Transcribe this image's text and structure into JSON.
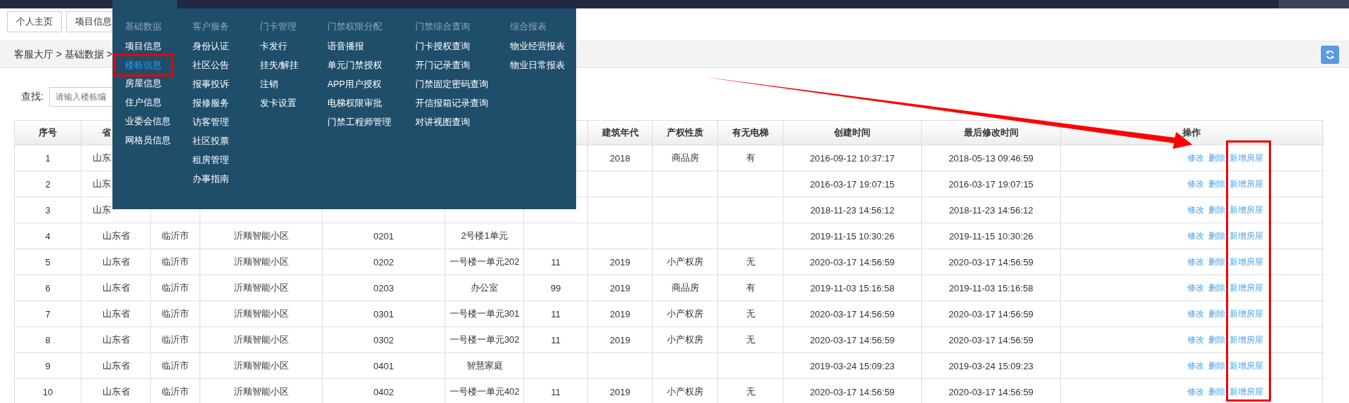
{
  "tabs": [
    {
      "label": "个人主页",
      "selected": false
    },
    {
      "label": "项目信息",
      "selected": false
    }
  ],
  "breadcrumb": "客服大厅 > 基础数据 >",
  "search": {
    "label": "查找:",
    "placeholder": "请输入楼栋编"
  },
  "menu": {
    "columns": [
      {
        "heading": "基础数据",
        "items": [
          {
            "label": "项目信息",
            "selected": false
          },
          {
            "label": "楼栋信息",
            "selected": true
          },
          {
            "label": "房屋信息",
            "selected": false
          },
          {
            "label": "住户信息",
            "selected": false
          },
          {
            "label": "业委会信息",
            "selected": false
          },
          {
            "label": "网格员信息",
            "selected": false
          }
        ]
      },
      {
        "heading": "客户服务",
        "items": [
          {
            "label": "身份认证",
            "selected": false
          },
          {
            "label": "社区公告",
            "selected": false
          },
          {
            "label": "报事投诉",
            "selected": false
          },
          {
            "label": "报修服务",
            "selected": false
          },
          {
            "label": "访客管理",
            "selected": false
          },
          {
            "label": "社区投票",
            "selected": false
          },
          {
            "label": "租房管理",
            "selected": false
          },
          {
            "label": "办事指南",
            "selected": false
          }
        ]
      },
      {
        "heading": "门卡管理",
        "items": [
          {
            "label": "卡发行",
            "selected": false
          },
          {
            "label": "挂失/解挂",
            "selected": false
          },
          {
            "label": "注销",
            "selected": false
          },
          {
            "label": "发卡设置",
            "selected": false
          }
        ]
      },
      {
        "heading": "门禁权限分配",
        "items": [
          {
            "label": "语音播报",
            "selected": false
          },
          {
            "label": "单元门禁授权",
            "selected": false
          },
          {
            "label": "APP用户授权",
            "selected": false
          },
          {
            "label": "电梯权限审批",
            "selected": false
          },
          {
            "label": "门禁工程师管理",
            "selected": false
          }
        ]
      },
      {
        "heading": "门禁综合查询",
        "items": [
          {
            "label": "门卡授权查询",
            "selected": false
          },
          {
            "label": "开门记录查询",
            "selected": false
          },
          {
            "label": "门禁固定密码查询",
            "selected": false
          },
          {
            "label": "开信报箱记录查询",
            "selected": false
          },
          {
            "label": "对讲视图查询",
            "selected": false
          }
        ]
      },
      {
        "heading": "综合报表",
        "items": [
          {
            "label": "物业经营报表",
            "selected": false
          },
          {
            "label": "物业日常报表",
            "selected": false
          }
        ]
      }
    ]
  },
  "table": {
    "columns": [
      "序号",
      "省",
      null,
      null,
      null,
      null,
      null,
      "建筑年代",
      "产权性质",
      "有无电梯",
      "创建时间",
      "最后修改时间",
      "操作"
    ],
    "rows": [
      {
        "cells": [
          "1",
          "山东",
          null,
          null,
          null,
          null,
          null,
          "2018",
          "商品房",
          "有",
          "2016-09-12 10:37:17",
          "2018-05-13 09:46:59"
        ],
        "actions": [
          "修改",
          "删除",
          "新增房屋"
        ]
      },
      {
        "cells": [
          "2",
          "山东",
          null,
          null,
          null,
          null,
          null,
          null,
          null,
          null,
          "2016-03-17 19:07:15",
          "2016-03-17 19:07:15"
        ],
        "actions": [
          "修改",
          "删除",
          "新增房屋"
        ]
      },
      {
        "cells": [
          "3",
          "山东",
          null,
          null,
          null,
          null,
          null,
          null,
          null,
          null,
          "2018-11-23 14:56:12",
          "2018-11-23 14:56:12"
        ],
        "actions": [
          "修改",
          "删除",
          "新增房屋"
        ]
      },
      {
        "cells": [
          "4",
          "山东省",
          "临沂市",
          "沂顺智能小区",
          "0201",
          "2号楼1单元",
          null,
          null,
          null,
          null,
          "2019-11-15 10:30:26",
          "2019-11-15 10:30:26"
        ],
        "actions": [
          "修改",
          "删除",
          "新增房屋"
        ]
      },
      {
        "cells": [
          "5",
          "山东省",
          "临沂市",
          "沂顺智能小区",
          "0202",
          "一号楼一单元202",
          "11",
          "2019",
          "小产权房",
          "无",
          "2020-03-17 14:56:59",
          "2020-03-17 14:56:59"
        ],
        "actions": [
          "修改",
          "删除",
          "新增房屋"
        ]
      },
      {
        "cells": [
          "6",
          "山东省",
          "临沂市",
          "沂顺智能小区",
          "0203",
          "办公室",
          "99",
          "2019",
          "商品房",
          "有",
          "2019-11-03 15:16:58",
          "2019-11-03 15:16:58"
        ],
        "actions": [
          "修改",
          "删除",
          "新增房屋"
        ]
      },
      {
        "cells": [
          "7",
          "山东省",
          "临沂市",
          "沂顺智能小区",
          "0301",
          "一号楼一单元301",
          "11",
          "2019",
          "小产权房",
          "无",
          "2020-03-17 14:56:59",
          "2020-03-17 14:56:59"
        ],
        "actions": [
          "修改",
          "删除",
          "新增房屋"
        ]
      },
      {
        "cells": [
          "8",
          "山东省",
          "临沂市",
          "沂顺智能小区",
          "0302",
          "一号楼一单元302",
          "11",
          "2019",
          "小产权房",
          "无",
          "2020-03-17 14:56:59",
          "2020-03-17 14:56:59"
        ],
        "actions": [
          "修改",
          "删除",
          "新增房屋"
        ]
      },
      {
        "cells": [
          "9",
          "山东省",
          "临沂市",
          "沂顺智能小区",
          "0401",
          "智慧家庭",
          null,
          null,
          null,
          null,
          "2019-03-24 15:09:23",
          "2019-03-24 15:09:23"
        ],
        "actions": [
          "修改",
          "删除",
          "新增房屋"
        ]
      },
      {
        "cells": [
          "10",
          "山东省",
          "临沂市",
          "沂顺智能小区",
          "0402",
          "一号楼一单元402",
          "11",
          "2019",
          "小产权房",
          "无",
          "2020-03-17 14:56:59",
          "2020-03-17 14:56:59"
        ],
        "actions": [
          "修改",
          "删除",
          "新增房屋"
        ]
      }
    ]
  }
}
